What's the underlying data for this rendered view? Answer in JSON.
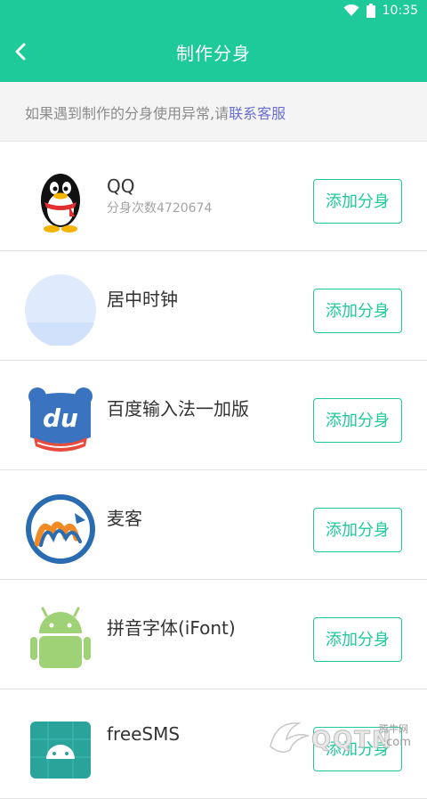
{
  "status": {
    "time": "10:35"
  },
  "header": {
    "title": "制作分身"
  },
  "notice": {
    "prefix": "如果遇到制作的分身使用异常,请",
    "link": "联系客服"
  },
  "apps": [
    {
      "name": "QQ",
      "sub": "分身次数4720674",
      "button": "添加分身",
      "icon": "qq-penguin-icon"
    },
    {
      "name": "居中时钟",
      "sub": "",
      "button": "添加分身",
      "icon": "clock-placeholder-icon"
    },
    {
      "name": "百度输入法一加版",
      "sub": "",
      "button": "添加分身",
      "icon": "baidu-du-icon"
    },
    {
      "name": "麦客",
      "sub": "",
      "button": "添加分身",
      "icon": "maike-m-icon"
    },
    {
      "name": "拼音字体(iFont)",
      "sub": "",
      "button": "添加分身",
      "icon": "android-robot-icon"
    },
    {
      "name": "freeSMS",
      "sub": "",
      "button": "添加分身",
      "icon": "freesms-android-icon"
    }
  ],
  "watermark": {
    "brand": "QQTN",
    "suffix": ".com",
    "tag": "腾牛网"
  }
}
